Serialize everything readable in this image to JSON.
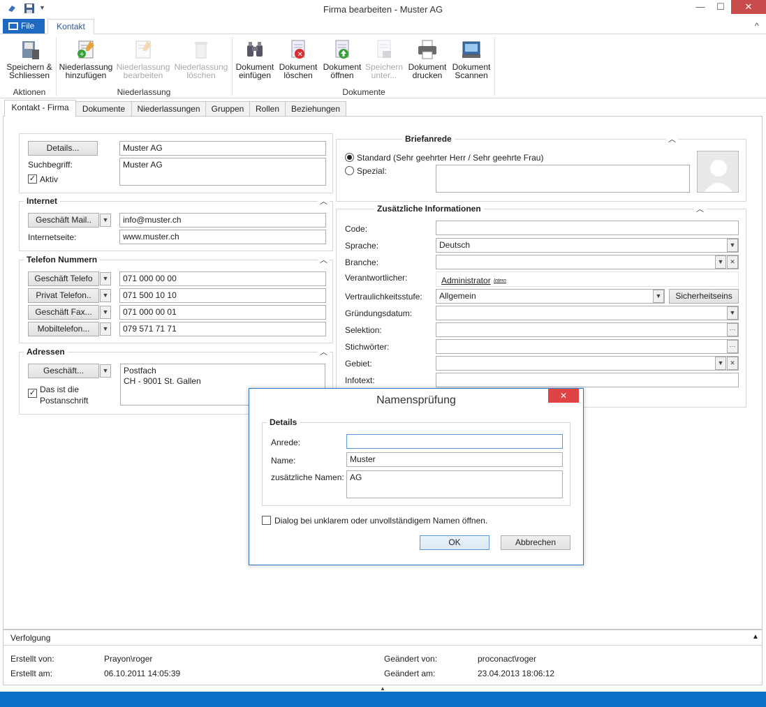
{
  "window": {
    "title": "Firma bearbeiten - Muster AG",
    "minimize": "—",
    "maximize": "☐",
    "close": "✕"
  },
  "menu": {
    "file_label": "File",
    "tab_label": "Kontakt",
    "collapse": "^"
  },
  "ribbon": {
    "buttons": [
      {
        "label1": "Speichern &",
        "label2": "Schliessen",
        "icon": "save-close-icon"
      },
      {
        "label1": "Niederlassung",
        "label2": "hinzufügen",
        "icon": "add-branch-icon"
      },
      {
        "label1": "Niederlassung",
        "label2": "bearbeiten",
        "icon": "edit-branch-icon"
      },
      {
        "label1": "Niederlassung",
        "label2": "löschen",
        "icon": "delete-branch-icon"
      },
      {
        "label1": "Dokument",
        "label2": "einfügen",
        "icon": "binoculars-icon"
      },
      {
        "label1": "Dokument",
        "label2": "löschen",
        "icon": "delete-document-icon"
      },
      {
        "label1": "Dokument",
        "label2": "öffnen",
        "icon": "open-document-icon"
      },
      {
        "label1": "Speichern",
        "label2": "unter...",
        "icon": "save-as-icon"
      },
      {
        "label1": "Dokument",
        "label2": "drucken",
        "icon": "printer-icon"
      },
      {
        "label1": "Dokument",
        "label2": "Scannen",
        "icon": "scanner-icon"
      }
    ],
    "groups": [
      "Aktionen",
      "Niederlassung",
      "Dokumente"
    ]
  },
  "tabs": [
    "Kontakt - Firma",
    "Dokumente",
    "Niederlassungen",
    "Gruppen",
    "Rollen",
    "Beziehungen"
  ],
  "company": {
    "details_button": "Details...",
    "name": "Muster AG",
    "search_label": "Suchbegriff:",
    "search_value": "Muster AG",
    "active_label": "Aktiv"
  },
  "internet": {
    "legend": "Internet",
    "mail_button": "Geschäft Mail..",
    "mail_value": "info@muster.ch",
    "web_label": "Internetseite:",
    "web_value": "www.muster.ch"
  },
  "phones": {
    "legend": "Telefon Nummern",
    "items": [
      {
        "label": "Geschäft Telefo",
        "value": "071 000 00 00"
      },
      {
        "label": "Privat Telefon..",
        "value": "071 500 10 10"
      },
      {
        "label": "Geschäft Fax...",
        "value": "071 000 00 01"
      },
      {
        "label": "Mobiltelefon...",
        "value": "079 571 71 71"
      }
    ]
  },
  "address": {
    "legend": "Adressen",
    "type_button": "Geschäft...",
    "line1": "Postfach",
    "line2": "CH - 9001 St. Gallen",
    "postal_label1": "Das ist die",
    "postal_label2": "Postanschrift"
  },
  "salutation": {
    "legend": "Briefanrede",
    "standard": "Standard (Sehr geehrter Herr / Sehr geehrte Frau)",
    "special": "Spezial:"
  },
  "info": {
    "legend": "Zusätzliche Informationen",
    "code_label": "Code:",
    "code_value": "",
    "language_label": "Sprache:",
    "language_value": "Deutsch",
    "branch_label": "Branche:",
    "branch_value": "",
    "responsible_label": "Verantwortlicher:",
    "responsible_value": "Administrator",
    "responsible_tag": "Intern",
    "confidentiality_label": "Vertraulichkeitsstufe:",
    "confidentiality_value": "Allgemein",
    "security_button": "Sicherheitseins",
    "founded_label": "Gründungsdatum:",
    "selection_label": "Selektion:",
    "keywords_label": "Stichwörter:",
    "area_label": "Gebiet:",
    "infotext_label": "Infotext:",
    "ellipsis": "···"
  },
  "tracking": {
    "title": "Verfolgung",
    "created_by_label": "Erstellt von:",
    "created_by": "Prayon\\roger",
    "created_at_label": "Erstellt am:",
    "created_at": "06.10.2011 14:05:39",
    "changed_by_label": "Geändert von:",
    "changed_by": "proconact\\roger",
    "changed_at_label": "Geändert am:",
    "changed_at": "23.04.2013 18:06:12"
  },
  "dialog": {
    "title": "Namensprüfung",
    "details_legend": "Details",
    "salutation_label": "Anrede:",
    "salutation_value": "",
    "name_label": "Name:",
    "name_value": "Muster",
    "extra_label": "zusätzliche Namen:",
    "extra_value": "AG",
    "checkbox_label": "Dialog bei unklarem oder unvollständigem Namen öffnen.",
    "ok": "OK",
    "cancel": "Abbrechen"
  },
  "colors": {
    "accent": "#1f6ac1",
    "statusbar": "#0a72c6",
    "close_red": "#e04343"
  }
}
